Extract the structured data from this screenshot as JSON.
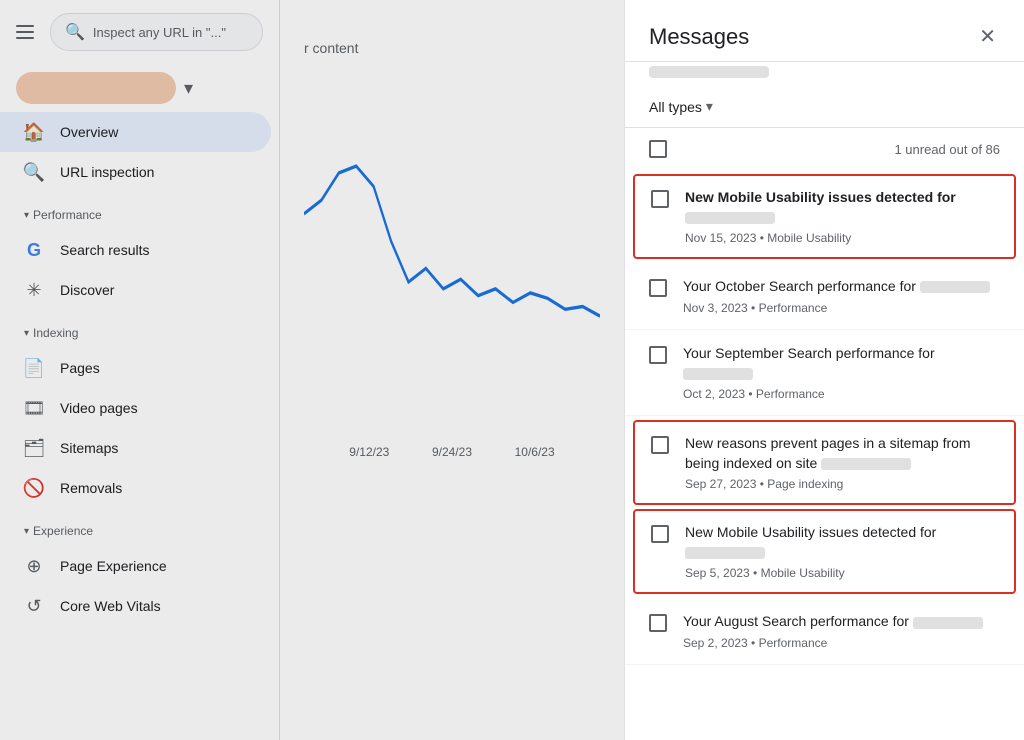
{
  "sidebar": {
    "search_placeholder": "Inspect any URL in \"...\"",
    "nav_items": [
      {
        "label": "Overview",
        "icon": "🏠",
        "active": true
      },
      {
        "label": "URL inspection",
        "icon": "🔍",
        "active": false
      }
    ],
    "sections": [
      {
        "label": "Performance",
        "items": [
          {
            "label": "Search results",
            "icon": "G"
          },
          {
            "label": "Discover",
            "icon": "✳"
          }
        ]
      },
      {
        "label": "Indexing",
        "items": [
          {
            "label": "Pages",
            "icon": "📄"
          },
          {
            "label": "Video pages",
            "icon": "🎞"
          },
          {
            "label": "Sitemaps",
            "icon": "🗂"
          },
          {
            "label": "Removals",
            "icon": "🚫"
          }
        ]
      },
      {
        "label": "Experience",
        "items": [
          {
            "label": "Page Experience",
            "icon": "⊕"
          },
          {
            "label": "Core Web Vitals",
            "icon": "↺"
          }
        ]
      }
    ]
  },
  "main": {
    "content_text": "r content",
    "x_labels": [
      "9/12/23",
      "9/24/23",
      "10/6/23"
    ]
  },
  "messages_panel": {
    "title": "Messages",
    "close_label": "✕",
    "filter": {
      "label": "All types",
      "arrow": "▾"
    },
    "unread_text": "1 unread out of 86",
    "items": [
      {
        "id": 1,
        "title": "New Mobile Usability issues detected for",
        "bold": true,
        "date": "Nov 15, 2023",
        "category": "Mobile Usability",
        "highlighted": true
      },
      {
        "id": 2,
        "title": "Your October Search performance for",
        "bold": false,
        "date": "Nov 3, 2023",
        "category": "Performance",
        "highlighted": false
      },
      {
        "id": 3,
        "title": "Your September Search performance for",
        "bold": false,
        "date": "Oct 2, 2023",
        "category": "Performance",
        "highlighted": false
      },
      {
        "id": 4,
        "title": "New reasons prevent pages in a sitemap from being indexed on site",
        "bold": false,
        "date": "Sep 27, 2023",
        "category": "Page indexing",
        "highlighted": true
      },
      {
        "id": 5,
        "title": "New Mobile Usability issues detected for",
        "bold": false,
        "date": "Sep 5, 2023",
        "category": "Mobile Usability",
        "highlighted": true
      },
      {
        "id": 6,
        "title": "Your August Search performance for",
        "bold": false,
        "date": "Sep 2, 2023",
        "category": "Performance",
        "highlighted": false
      }
    ]
  }
}
